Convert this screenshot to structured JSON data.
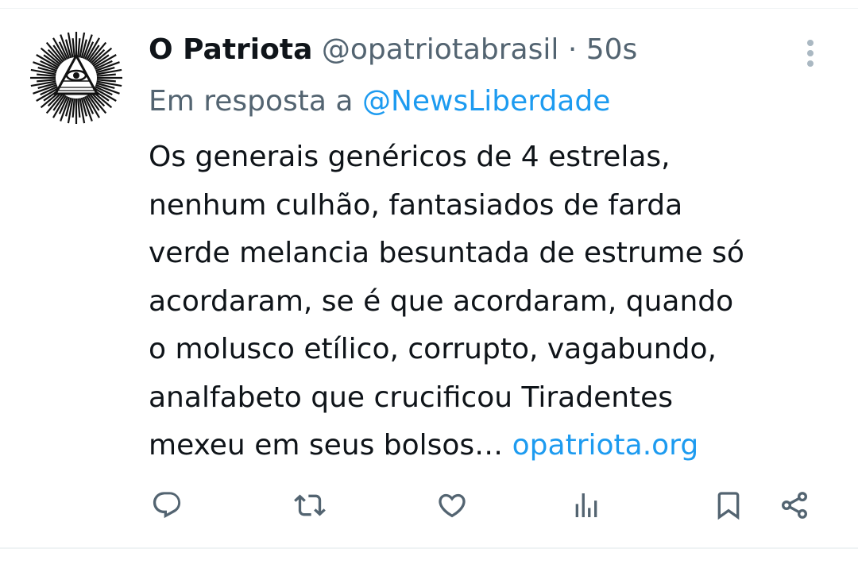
{
  "tweet": {
    "display_name": "O Patriota",
    "handle": "@opatriotabrasil",
    "separator": "·",
    "time": "50s",
    "reply_prefix": "Em resposta a",
    "reply_to": "@NewsLiberdade",
    "body_lines": [
      "Os generais genéricos de 4 estrelas,",
      "nenhum culhão, fantasiados de farda",
      "verde melancia besuntada de estrume só",
      "acordaram, se é que acordaram, quando",
      "o molusco etílico, corrupto, vagabundo,",
      "analfabeto que crucificou Tiradentes",
      "mexeu em seus bolsos…"
    ],
    "link_text": "opatriota.org"
  },
  "icons": {
    "avatar": "all-seeing-eye-pyramid-icon",
    "more": "more-vertical-icon",
    "reply": "reply-icon",
    "retweet": "retweet-icon",
    "like": "like-icon",
    "views": "views-icon",
    "bookmark": "bookmark-icon",
    "share": "share-icon"
  },
  "colors": {
    "text": "#0f1419",
    "secondary": "#536471",
    "link": "#1d9bf0"
  }
}
